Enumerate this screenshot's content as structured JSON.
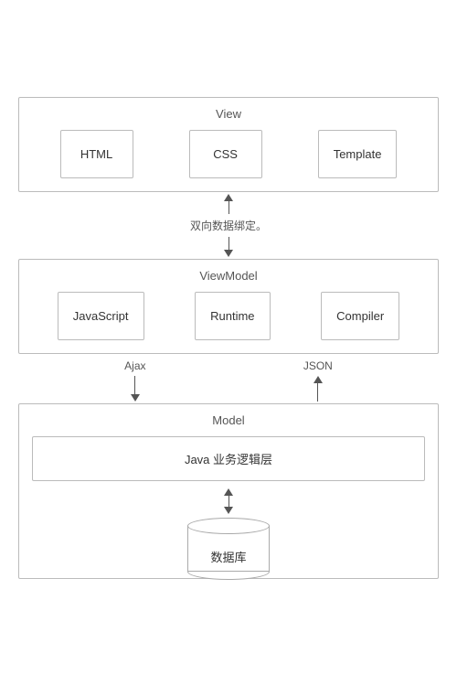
{
  "view": {
    "label": "View",
    "items": [
      {
        "id": "html",
        "label": "HTML"
      },
      {
        "id": "css",
        "label": "CSS"
      },
      {
        "id": "template",
        "label": "Template"
      }
    ]
  },
  "binding_label": "双向数据绑定。",
  "viewmodel": {
    "label": "ViewModel",
    "items": [
      {
        "id": "javascript",
        "label": "JavaScript"
      },
      {
        "id": "runtime",
        "label": "Runtime"
      },
      {
        "id": "compiler",
        "label": "Compiler"
      }
    ]
  },
  "ajax_label": "Ajax",
  "json_label": "JSON",
  "model": {
    "label": "Model",
    "java_label": "Java 业务逻辑层",
    "db_label": "数据库"
  }
}
